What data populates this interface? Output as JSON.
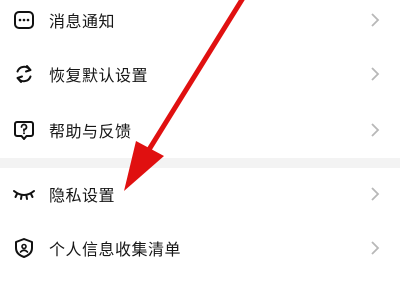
{
  "settings": {
    "items": [
      {
        "label": "消息通知",
        "icon": "message-icon"
      },
      {
        "label": "恢复默认设置",
        "icon": "refresh-icon"
      },
      {
        "label": "帮助与反馈",
        "icon": "help-icon"
      },
      {
        "label": "隐私设置",
        "icon": "eye-closed-icon"
      },
      {
        "label": "个人信息收集清单",
        "icon": "shield-icon"
      }
    ]
  },
  "colors": {
    "annotation_arrow": "#e01010",
    "chevron": "#b8b8b8",
    "divider": "#f3f3f3"
  }
}
